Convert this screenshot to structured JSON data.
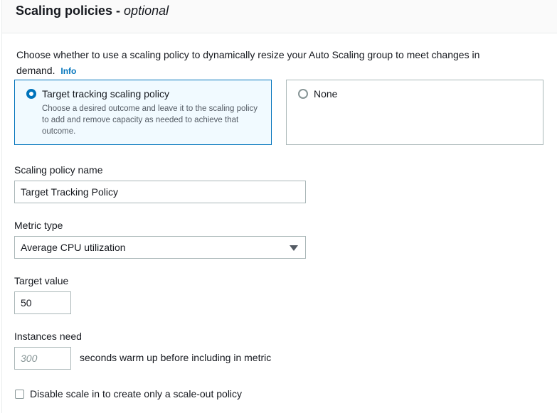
{
  "section": {
    "title": "Scaling policies - ",
    "title_suffix": "optional",
    "description": "Choose whether to use a scaling policy to dynamically resize your Auto Scaling group to meet changes in demand.",
    "info_label": "Info"
  },
  "policy_options": {
    "target_tracking": {
      "label": "Target tracking scaling policy",
      "description": "Choose a desired outcome and leave it to the scaling policy to add and remove capacity as needed to achieve that outcome.",
      "selected": true
    },
    "none": {
      "label": "None",
      "selected": false
    }
  },
  "policy_name": {
    "label": "Scaling policy name",
    "value": "Target Tracking Policy"
  },
  "metric_type": {
    "label": "Metric type",
    "selected": "Average CPU utilization"
  },
  "target_value": {
    "label": "Target value",
    "value": "50"
  },
  "instances_need": {
    "label": "Instances need",
    "placeholder": "300",
    "suffix_text": "seconds warm up before including in metric"
  },
  "disable_scale_in": {
    "label": "Disable scale in to create only a scale-out policy",
    "checked": false
  },
  "colors": {
    "accent": "#0073bb",
    "selected_tile_bg": "#f1faff",
    "border": "#aab7b8"
  }
}
